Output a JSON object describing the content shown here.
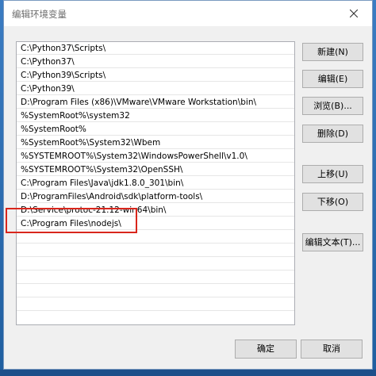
{
  "window": {
    "title": "编辑环境变量"
  },
  "paths": [
    "C:\\Python37\\Scripts\\",
    "C:\\Python37\\",
    "C:\\Python39\\Scripts\\",
    "C:\\Python39\\",
    "D:\\Program Files (x86)\\VMware\\VMware Workstation\\bin\\",
    "%SystemRoot%\\system32",
    "%SystemRoot%",
    "%SystemRoot%\\System32\\Wbem",
    "%SYSTEMROOT%\\System32\\WindowsPowerShell\\v1.0\\",
    "%SYSTEMROOT%\\System32\\OpenSSH\\",
    "C:\\Program Files\\Java\\jdk1.8.0_301\\bin\\",
    "D:\\ProgramFiles\\Android\\sdk\\platform-tools\\",
    "D:\\Service\\protoc-21.12-win64\\bin\\",
    "C:\\Program Files\\nodejs\\"
  ],
  "buttons": {
    "new": "新建(N)",
    "edit": "编辑(E)",
    "browse": "浏览(B)...",
    "delete": "删除(D)",
    "move_up": "上移(U)",
    "move_down": "下移(O)",
    "edit_text": "编辑文本(T)...",
    "ok": "确定",
    "cancel": "取消"
  },
  "colors": {
    "highlight": "#d9261c",
    "desktop": "#2f6fb0"
  }
}
